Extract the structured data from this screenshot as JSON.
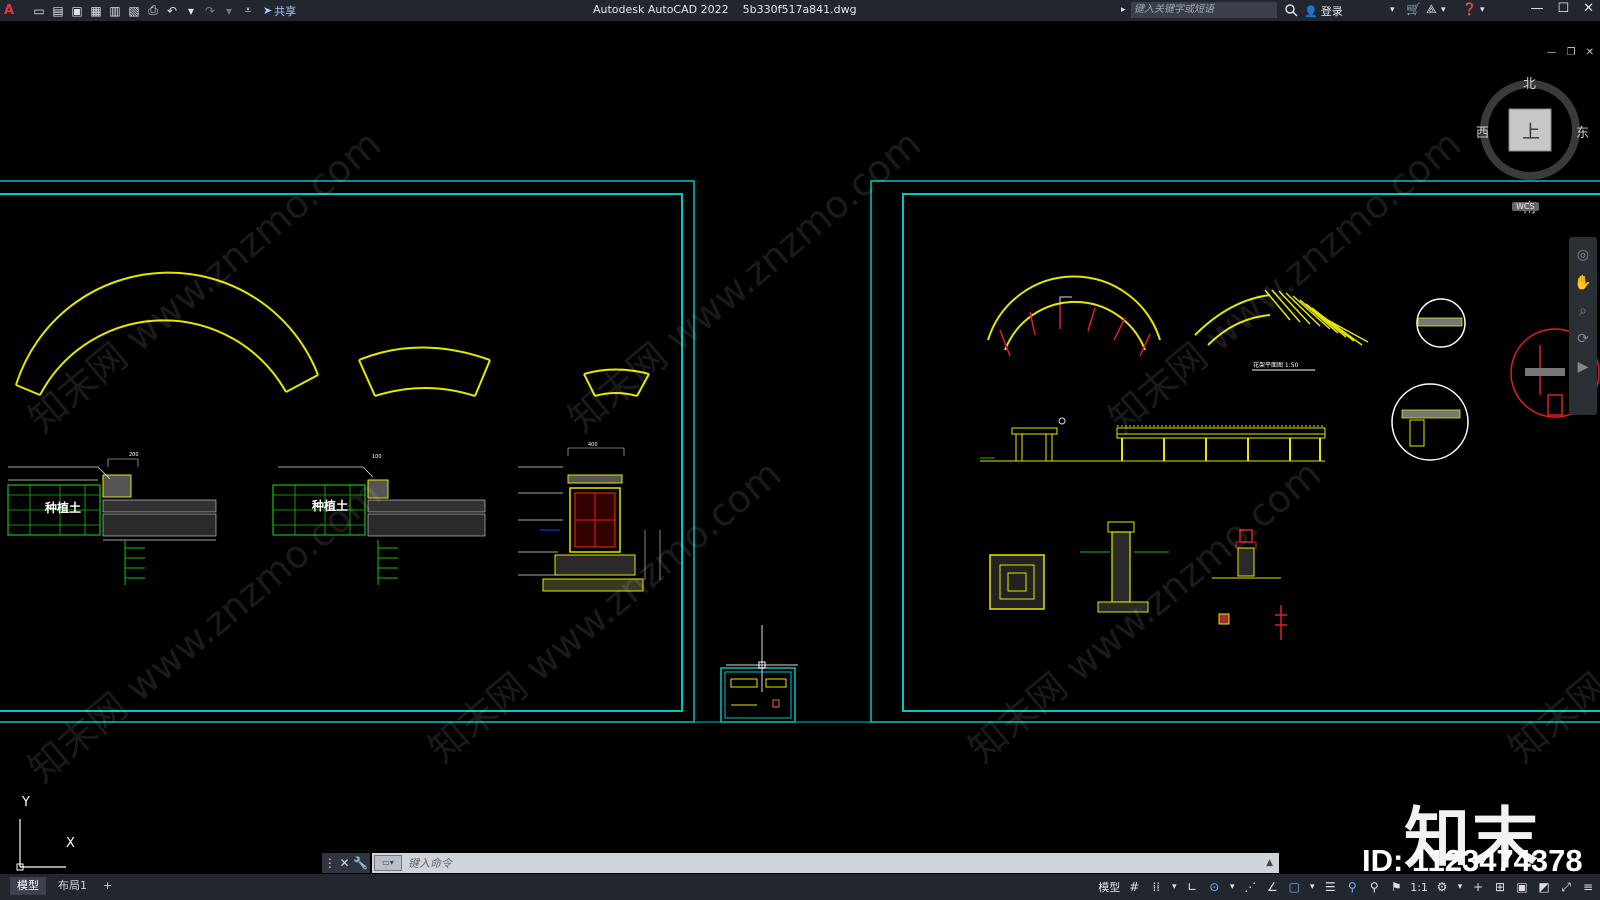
{
  "app": {
    "title": "Autodesk AutoCAD 2022",
    "file": "5b330f517a841.dwg",
    "logo": "A",
    "share_label": "共享",
    "search_placeholder": "键入关键字或短语",
    "login_label": "登录",
    "accent": "#00c6c6"
  },
  "viewcube": {
    "north": "北",
    "south": "南",
    "east": "东",
    "west": "西",
    "face": "上",
    "wcs": "WCS"
  },
  "ucs": {
    "x": "X",
    "y": "Y"
  },
  "command": {
    "placeholder": "键入命令"
  },
  "tabs": [
    {
      "label": "模型"
    },
    {
      "label": "布局1"
    },
    {
      "label": "+"
    }
  ],
  "status": {
    "model": "模型",
    "scale": "1:1"
  },
  "drawing": {
    "label_left_1": "种植土",
    "label_left_2": "种植土",
    "right_caption": "花架平面图 1:50",
    "dim_200": "200",
    "dim_100": "100",
    "dim_400": "400"
  },
  "watermark": {
    "text": "知末网 www.znzmo.com",
    "brand": "知末",
    "id": "ID: 1123474378"
  },
  "colors": {
    "frame": "#00c6c6",
    "linework": "#e6e600",
    "red": "#e02020",
    "green": "#10c010"
  }
}
